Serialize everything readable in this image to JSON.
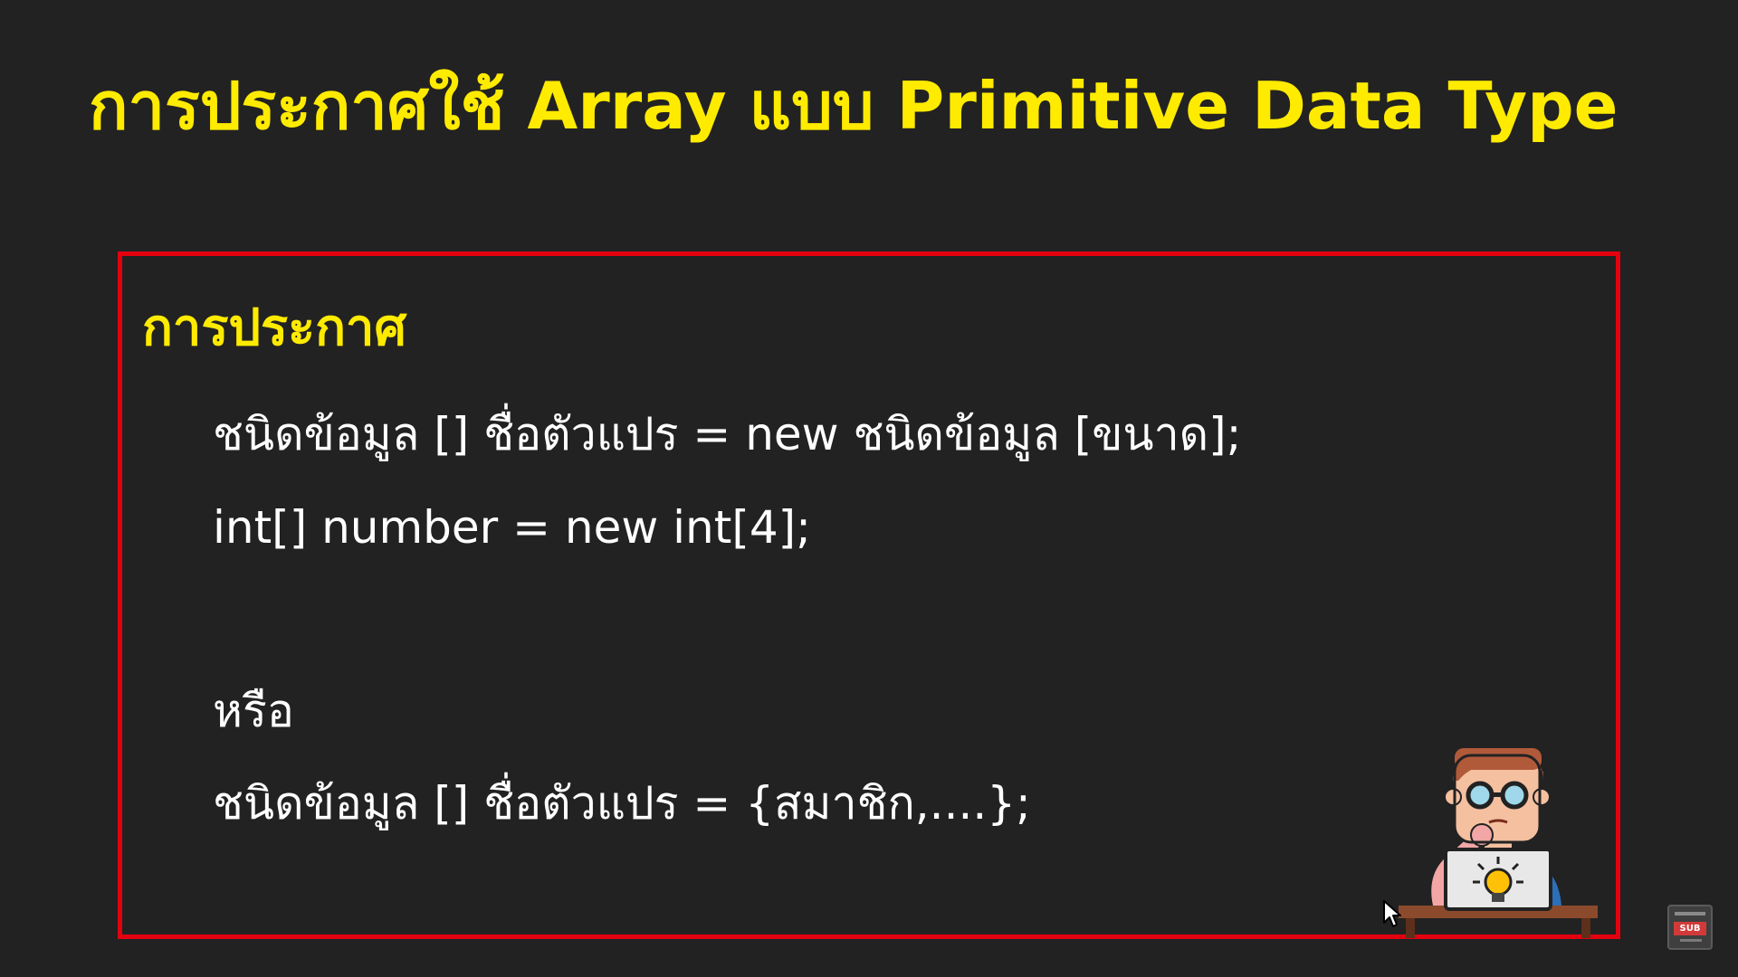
{
  "slide": {
    "title": "การประกาศใช้ Array แบบ Primitive Data Type",
    "title_color": "#ffeb00",
    "section_heading": "การประกาศ",
    "heading_color": "#ffeb00",
    "lines": [
      "ชนิดข้อมูล [] ชื่อตัวแปร = new ชนิดข้อมูล [ขนาด];",
      "int[] number = new int[4];",
      "หรือ",
      "ชนิดข้อมูล [] ชื่อตัวแปร = {สมาชิก,....};"
    ],
    "frame_color": "#e3000f",
    "background": "#222222"
  },
  "overlay": {
    "badge_label": "SUB"
  }
}
